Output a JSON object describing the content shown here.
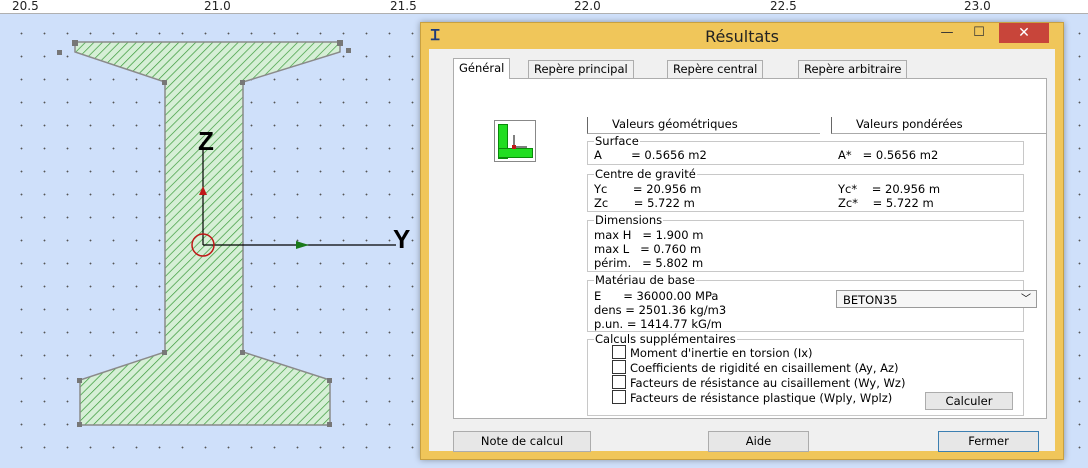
{
  "ruler": {
    "ticks": [
      "20.5",
      "21.0",
      "21.5",
      "22.0",
      "22.5",
      "23.0"
    ]
  },
  "canvas": {
    "axis_y_label": "Y",
    "axis_z_label": "Z",
    "colors": {
      "background": "#cfe0fa",
      "hatch": "#3a9a3a",
      "fill": "#d6efd6",
      "outline": "#8a8a8a",
      "axis_arrow": "#1a7a1a",
      "centroid": "#c01818"
    }
  },
  "window": {
    "icon": "beam-section-icon",
    "title": "Résultats",
    "minimize": "—",
    "maximize": "☐",
    "close": "✕"
  },
  "tabs": [
    {
      "label": "Général",
      "active": true
    },
    {
      "label": "Repère principal",
      "active": false
    },
    {
      "label": "Repère central",
      "active": false
    },
    {
      "label": "Repère arbitraire",
      "active": false
    }
  ],
  "section_icon": "l-section-icon",
  "headers": {
    "geometric": "Valeurs géométriques",
    "weighted": "Valeurs pondérées"
  },
  "surface": {
    "title": "Surface",
    "geo": "A        = 0.5656 m2",
    "pond": "A*   = 0.5656 m2"
  },
  "gravity": {
    "title": "Centre de gravité",
    "yc": "Yc       = 20.956 m",
    "zc": "Zc       = 5.722 m",
    "yc_pond": "Yc*    = 20.956 m",
    "zc_pond": "Zc*    = 5.722 m"
  },
  "dimensions": {
    "title": "Dimensions",
    "h": "max H   = 1.900 m",
    "l": "max L   = 0.760 m",
    "p": "périm.   = 5.802 m"
  },
  "material": {
    "title": "Matériau de base",
    "e": "E      = 36000.00 MPa",
    "dens": "dens = 2501.36 kg/m3",
    "pun": "p.un. = 1414.77 kG/m",
    "selected": "BETON35"
  },
  "extra": {
    "title": "Calculs supplémentaires",
    "options": [
      {
        "label": "Moment d'inertie en torsion (Ix)",
        "checked": false
      },
      {
        "label": "Coefficients de rigidité en cisaillement (Ay, Az)",
        "checked": false
      },
      {
        "label": "Facteurs de résistance au cisaillement (Wy, Wz)",
        "checked": false
      },
      {
        "label": "Facteurs de résistance plastique (Wply, Wplz)",
        "checked": false
      }
    ],
    "compute": "Calculer"
  },
  "footer": {
    "report": "Note de calcul",
    "help": "Aide",
    "close": "Fermer"
  }
}
